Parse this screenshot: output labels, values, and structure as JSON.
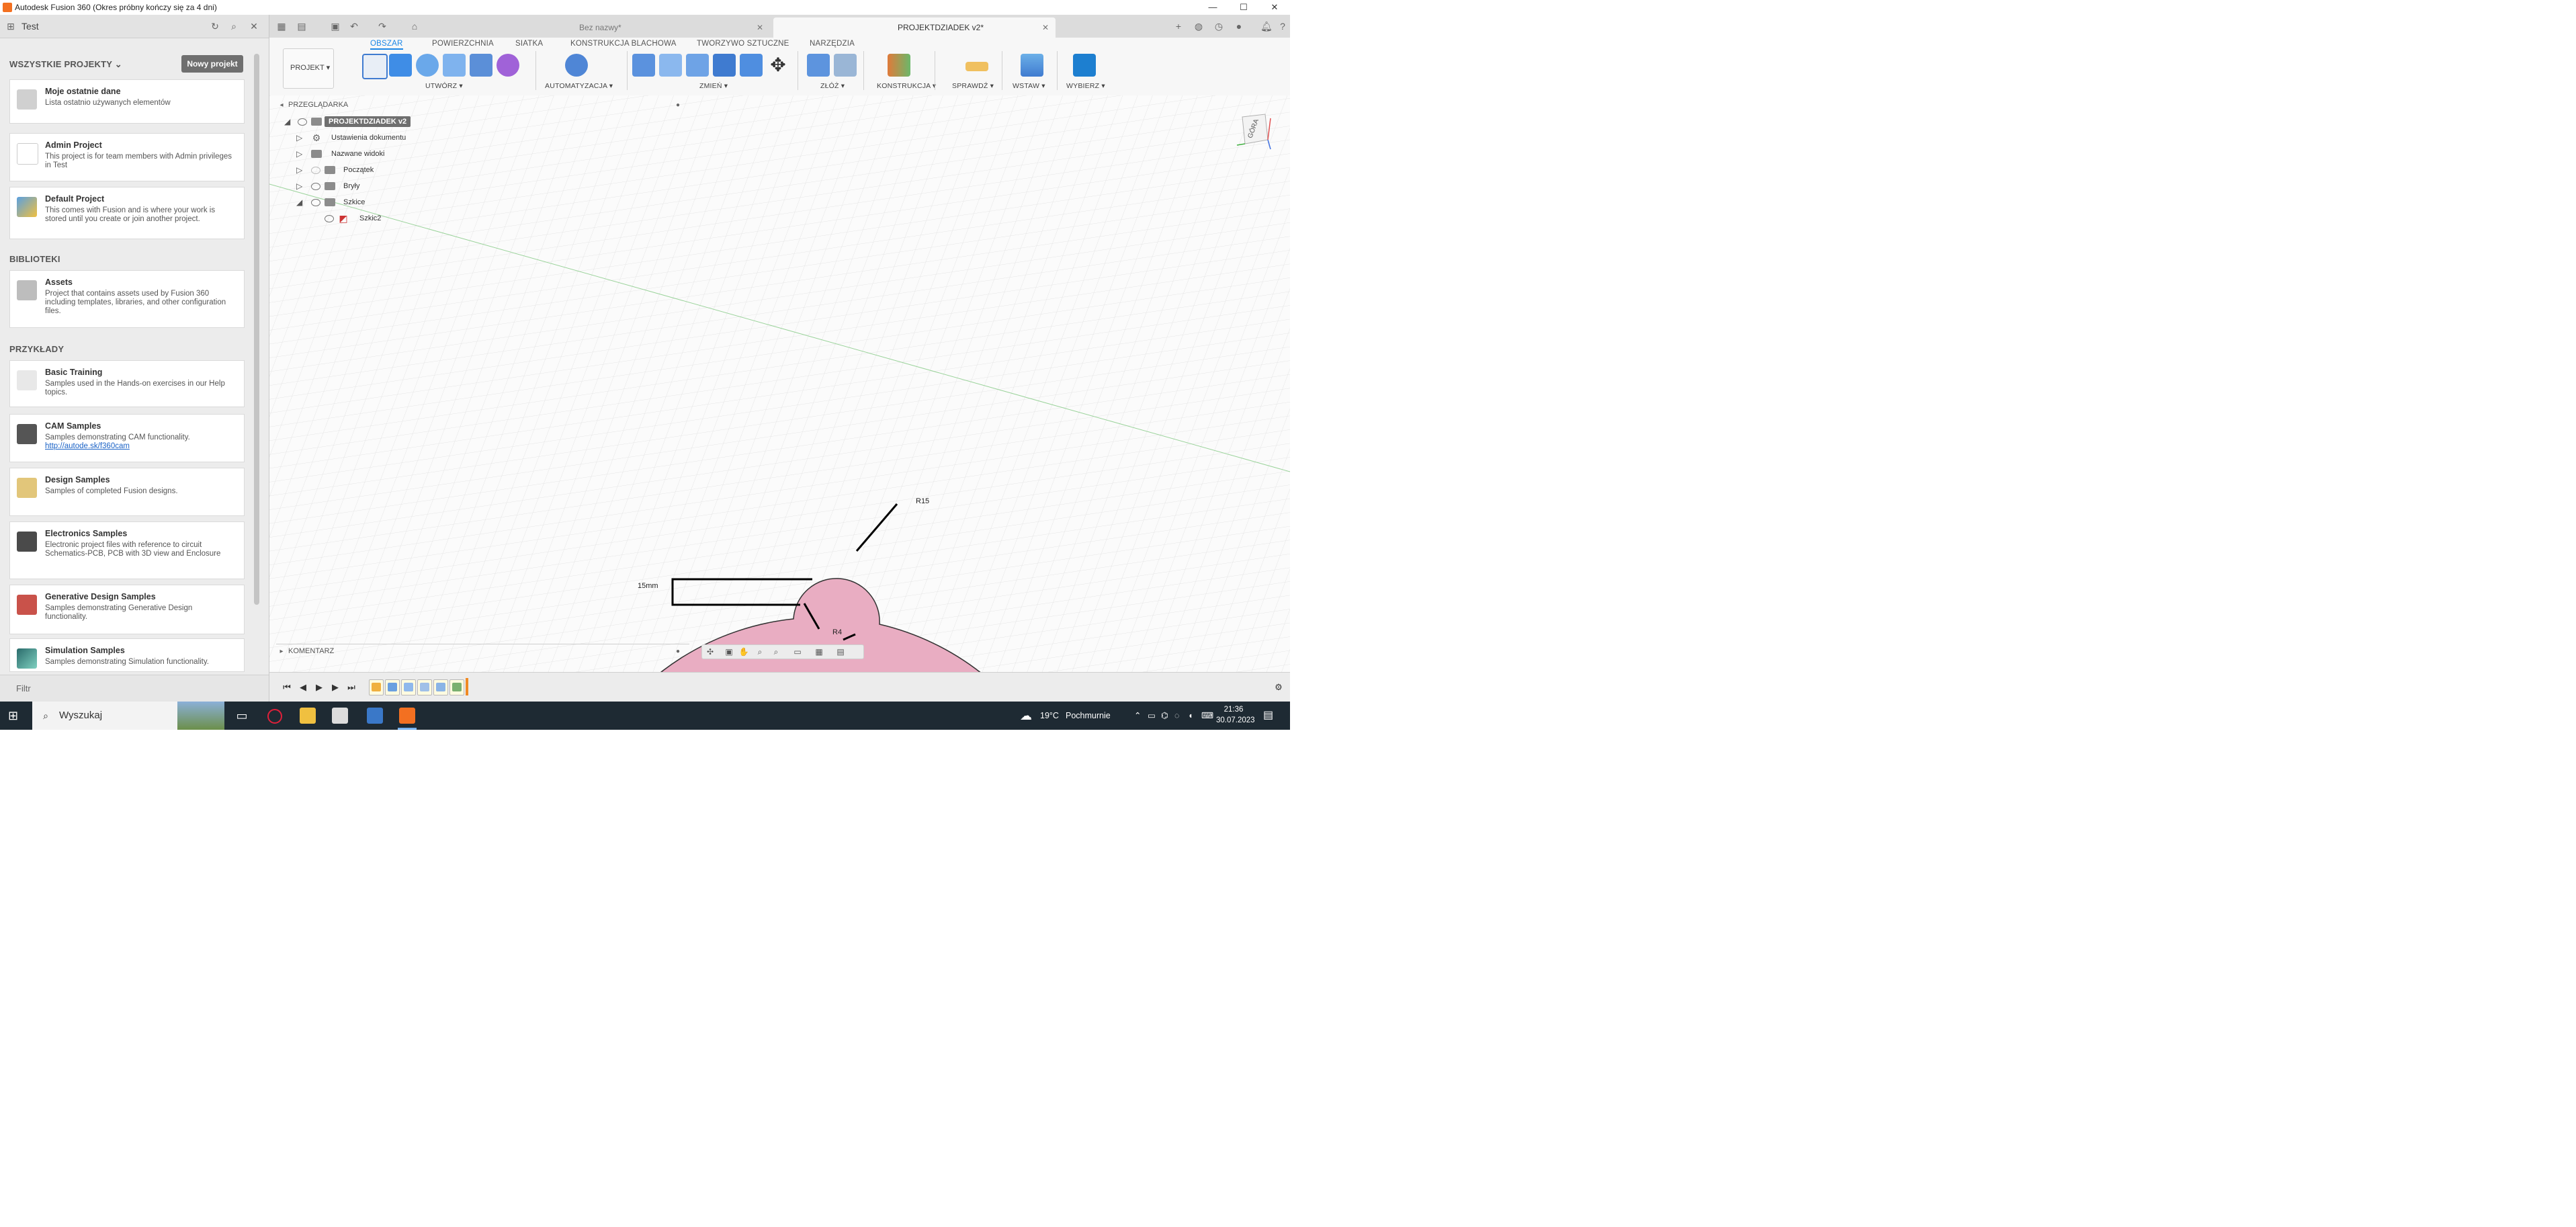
{
  "window": {
    "title": "Autodesk Fusion 360 (Okres próbny kończy się za 4 dni)",
    "controls": {
      "minimize": "—",
      "maximize": "☐",
      "close": "✕"
    }
  },
  "data_panel": {
    "team_name": "Test",
    "section_projects": "WSZYSTKIE PROJEKTY",
    "new_project_button": "Nowy projekt",
    "projects": [
      {
        "name": "Moje ostatnie dane",
        "desc": "Lista ostatnio używanych elementów"
      },
      {
        "name": "Admin Project",
        "desc": "This project is for team members with Admin privileges in Test"
      },
      {
        "name": "Default Project",
        "desc": "This comes with Fusion and is where your work is stored until you create or join another project."
      }
    ],
    "section_libraries": "BIBLIOTEKI",
    "libraries": [
      {
        "name": "Assets",
        "desc": "Project that contains assets used by Fusion 360 including templates, libraries, and other configuration files."
      }
    ],
    "section_samples": "PRZYKŁADY",
    "samples": [
      {
        "name": "Basic Training",
        "desc": "Samples used in the Hands-on exercises in our Help topics."
      },
      {
        "name": "CAM Samples",
        "desc": "Samples demonstrating CAM functionality.",
        "link": "http://autode.sk/f360cam"
      },
      {
        "name": "Design Samples",
        "desc": "Samples of completed Fusion designs."
      },
      {
        "name": "Electronics Samples",
        "desc": "Electronic project files with reference to circuit Schematics-PCB, PCB with 3D view and Enclosure"
      },
      {
        "name": "Generative Design Samples",
        "desc": "Samples demonstrating Generative Design functionality."
      },
      {
        "name": "Simulation Samples",
        "desc": "Samples demonstrating Simulation functionality."
      }
    ],
    "filter_label": "Filtr"
  },
  "doc_tabs": [
    {
      "label": "Bez nazwy*",
      "active": false
    },
    {
      "label": "PROJEKTDZIADEK v2*",
      "active": true
    }
  ],
  "ribbon": {
    "workspace_button": "PROJEKT ▾",
    "tabs": [
      "OBSZAR",
      "POWIERZCHNIA",
      "SIATKA",
      "KONSTRUKCJA BLACHOWA",
      "TWORZYWO SZTUCZNE",
      "NARZĘDZIA"
    ],
    "active_tab": "OBSZAR",
    "groups": [
      "UTWÓRZ ▾",
      "AUTOMATYZACJA ▾",
      "ZMIEŃ ▾",
      "ZŁÓŻ ▾",
      "KONSTRUKCJA ▾",
      "SPRAWDŹ ▾",
      "WSTAW ▾",
      "WYBIERZ ▾"
    ]
  },
  "browser": {
    "title": "PRZEGLĄDARKA",
    "root": "PROJEKTDZIADEK v2",
    "items": [
      {
        "label": "Ustawienia dokumentu",
        "indent": 1
      },
      {
        "label": "Nazwane widoki",
        "indent": 1
      },
      {
        "label": "Początek",
        "indent": 1
      },
      {
        "label": "Bryły",
        "indent": 1
      },
      {
        "label": "Szkice",
        "indent": 1
      },
      {
        "label": "Szkic2",
        "indent": 2
      }
    ]
  },
  "sketch": {
    "dimension_radius_large": "R15",
    "dimension_radius_small": "R4",
    "dimension_length": "15mm",
    "fill_color": "#e9adc2"
  },
  "viewcube": {
    "face": "GÓRA"
  },
  "comments_label": "KOMENTARZ",
  "taskbar": {
    "search_placeholder": "Wyszukaj",
    "weather_temp": "19°C",
    "weather_desc": "Pochmurnie",
    "time": "21:36",
    "date": "30.07.2023"
  }
}
